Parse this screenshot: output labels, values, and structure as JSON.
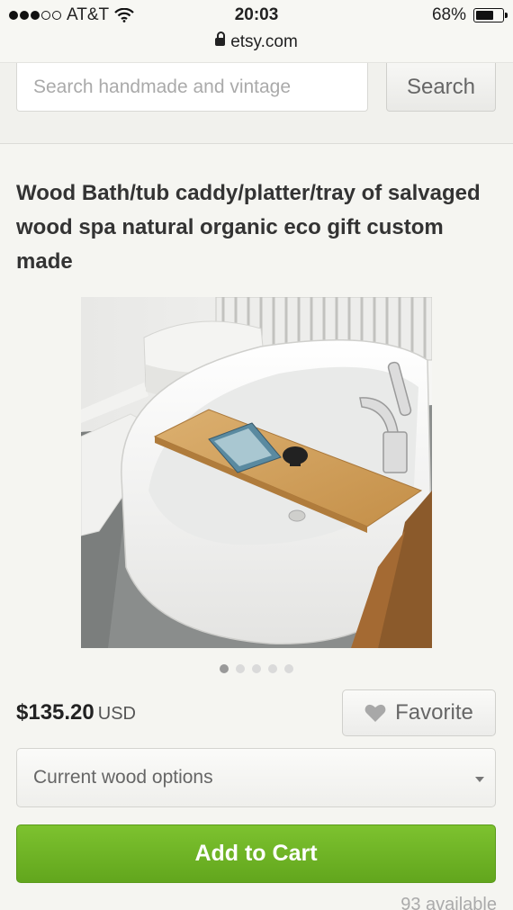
{
  "status_bar": {
    "carrier": "AT&T",
    "time": "20:03",
    "battery": "68%",
    "battery_level": 0.68,
    "signal_bars_filled": 3,
    "signal_bars_total": 5
  },
  "browser": {
    "url": "etsy.com"
  },
  "search": {
    "placeholder": "Search handmade and vintage",
    "button_label": "Search"
  },
  "listing": {
    "title": "Wood Bath/tub caddy/platter/tray of salvaged wood spa natural organic eco gift custom made",
    "price": "$135.20",
    "currency": "USD",
    "favorite_label": "Favorite",
    "option_select": "Current wood options",
    "add_to_cart_label": "Add to Cart",
    "availability": "93 available",
    "image_count": 5,
    "active_image": 1
  },
  "colors": {
    "accent_green": "#6fb526",
    "page_bg": "#f5f5f1"
  }
}
